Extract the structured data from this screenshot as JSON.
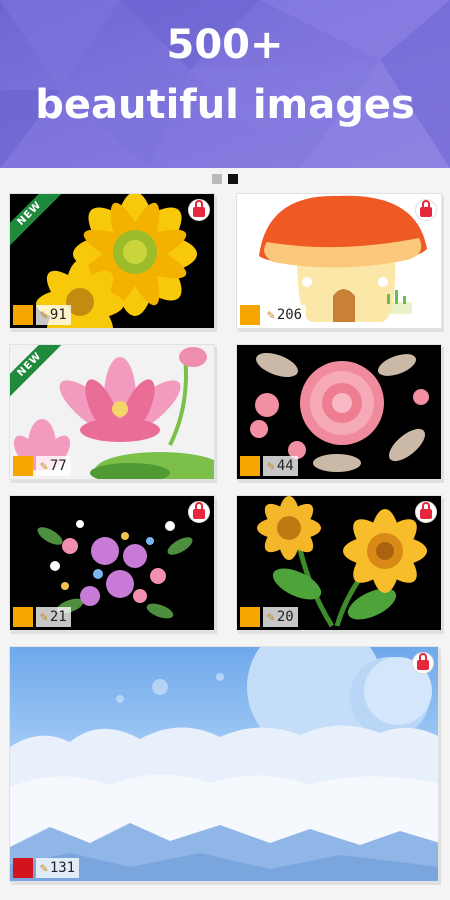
{
  "banner": {
    "line1": "500+",
    "line2": "beautiful images",
    "bg_color": "#7a70da"
  },
  "pager": {
    "pages": 2,
    "active_index": 1
  },
  "lock_icon": "lock-icon",
  "pencil_icon": "pencil-icon",
  "tiles": [
    {
      "subject": "sunflowers-yellow",
      "count": "91",
      "swatch": "#f7a500",
      "new": true,
      "new_label": "NEW",
      "locked": true
    },
    {
      "subject": "mushroom-house",
      "count": "206",
      "swatch": "#f7a500",
      "new": false,
      "locked": true
    },
    {
      "subject": "pink-lotus",
      "count": "77",
      "swatch": "#f7a500",
      "new": true,
      "new_label": "NEW",
      "locked": false
    },
    {
      "subject": "pink-rose",
      "count": "44",
      "swatch": "#f7a500",
      "new": false,
      "locked": false
    },
    {
      "subject": "flower-bouquet",
      "count": "21",
      "swatch": "#f7a500",
      "new": false,
      "locked": true
    },
    {
      "subject": "two-sunflowers",
      "count": "20",
      "swatch": "#f7a500",
      "new": false,
      "locked": true
    },
    {
      "subject": "sky-planets-clouds",
      "count": "131",
      "swatch": "#d3141d",
      "new": false,
      "locked": true
    }
  ]
}
